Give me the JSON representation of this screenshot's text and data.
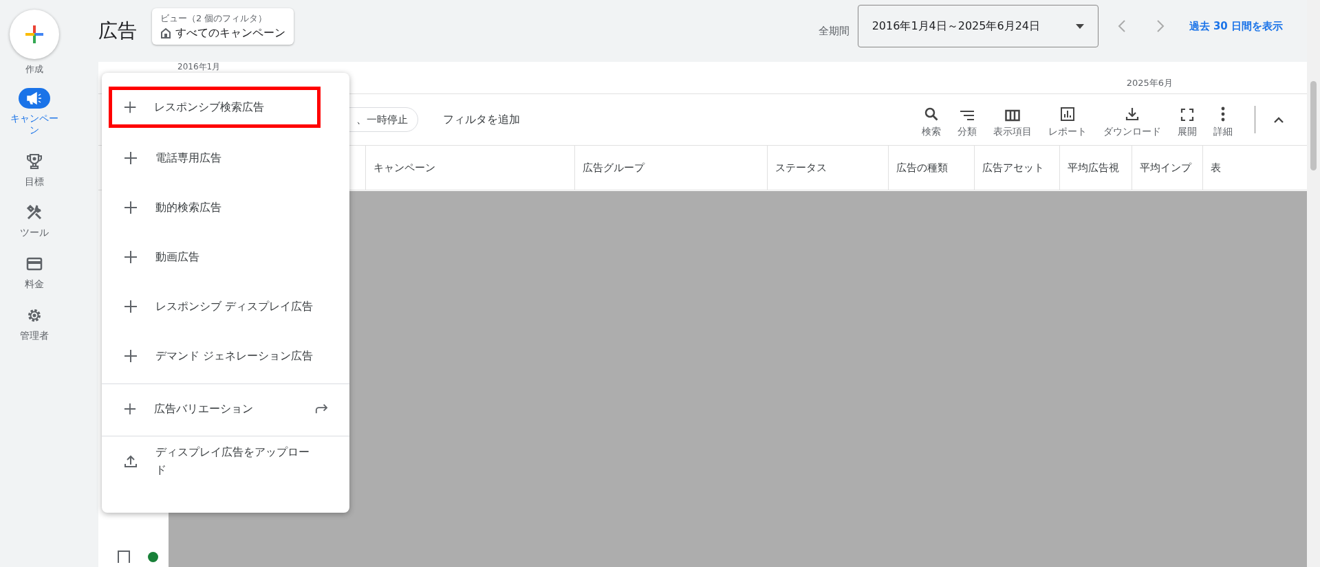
{
  "sidebar": {
    "create_label": "作成",
    "items": [
      {
        "kind": "campaign",
        "label": "キャンペーン",
        "selected": true
      },
      {
        "kind": "goal",
        "label": "目標",
        "selected": false
      },
      {
        "kind": "tools",
        "label": "ツール",
        "selected": false
      },
      {
        "kind": "billing",
        "label": "料金",
        "selected": false
      },
      {
        "kind": "admin",
        "label": "管理者",
        "selected": false
      }
    ]
  },
  "header": {
    "title": "広告",
    "view": {
      "caption": "ビュー（2 個のフィルタ）",
      "name": "すべてのキャンペーン"
    },
    "period_label": "全期間",
    "date_range": "2016年1月4日～2025年6月24日",
    "link": "過去 30 日間を表示"
  },
  "chart_axis": {
    "start": "2016年1月",
    "end": "2025年6月"
  },
  "toolbar": {
    "filter_chip": "、一時停止",
    "add_filter": "フィルタを追加",
    "actions": [
      {
        "kind": "search",
        "label": "検索"
      },
      {
        "kind": "segment",
        "label": "分類"
      },
      {
        "kind": "columns",
        "label": "表示項目"
      },
      {
        "kind": "report",
        "label": "レポート"
      },
      {
        "kind": "download",
        "label": "ダウンロード"
      },
      {
        "kind": "expand",
        "label": "展開"
      },
      {
        "kind": "more",
        "label": "詳細"
      }
    ]
  },
  "table": {
    "columns": [
      "キャンペーン",
      "広告グループ",
      "ステータス",
      "広告の種類",
      "広告アセット",
      "平均広告視",
      "平均インプ",
      "表"
    ],
    "rows": [
      {
        "checked": false,
        "color": "#188038"
      }
    ]
  },
  "menu": {
    "items": [
      {
        "kind": "add",
        "label": "レスポンシブ検索広告",
        "highlighted": true,
        "divider_before": false,
        "redirect": false
      },
      {
        "kind": "add",
        "label": "電話専用広告",
        "highlighted": false,
        "divider_before": false,
        "redirect": false
      },
      {
        "kind": "add",
        "label": "動的検索広告",
        "highlighted": false,
        "divider_before": false,
        "redirect": false
      },
      {
        "kind": "add",
        "label": "動画広告",
        "highlighted": false,
        "divider_before": false,
        "redirect": false
      },
      {
        "kind": "add",
        "label": "レスポンシブ ディスプレイ広告",
        "highlighted": false,
        "divider_before": false,
        "redirect": false
      },
      {
        "kind": "add",
        "label": "デマンド ジェネレーション広告",
        "highlighted": false,
        "divider_before": false,
        "redirect": false
      },
      {
        "kind": "add",
        "label": "広告バリエーション",
        "highlighted": false,
        "divider_before": true,
        "redirect": true
      },
      {
        "kind": "upload",
        "label": "ディスプレイ広告をアップロード",
        "highlighted": false,
        "divider_before": true,
        "redirect": false
      }
    ]
  }
}
